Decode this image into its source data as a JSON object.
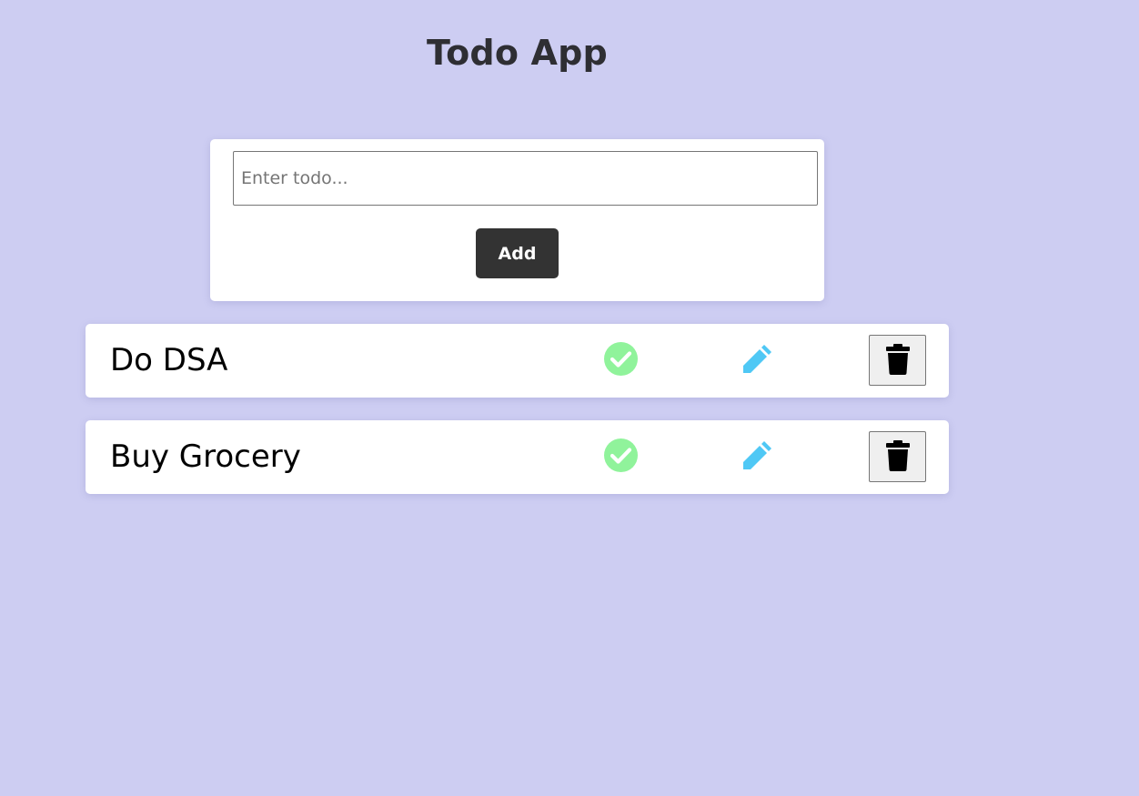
{
  "app": {
    "title": "Todo App"
  },
  "form": {
    "input_value": "",
    "input_placeholder": "Enter todo...",
    "add_label": "Add"
  },
  "todos": [
    {
      "text": "Do DSA"
    },
    {
      "text": "Buy Grocery"
    }
  ],
  "icons": {
    "complete": "check-circle-icon",
    "edit": "pencil-icon",
    "delete": "trash-icon"
  },
  "colors": {
    "background": "#cdcdf2",
    "button": "#333333",
    "complete": "#90f39b",
    "edit": "#4fc8f5",
    "title": "#2e2e33"
  }
}
